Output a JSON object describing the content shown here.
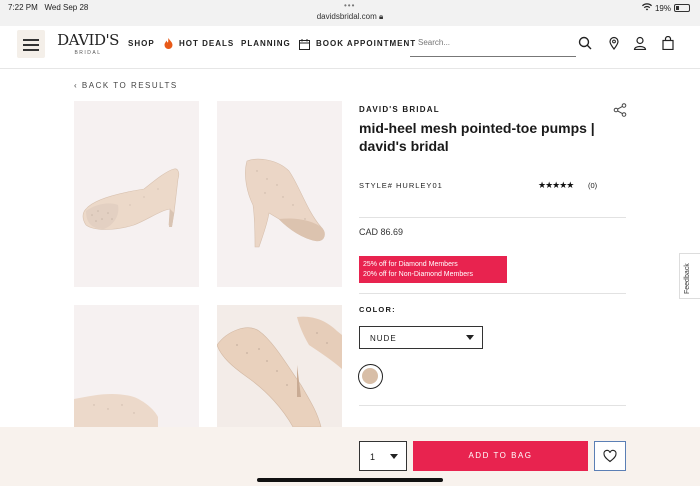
{
  "statusbar": {
    "time": "7:22 PM",
    "date": "Wed Sep 28",
    "url": "davidsbridal.com",
    "battery": "19%"
  },
  "header": {
    "logo": "DAVID'S",
    "logo_sub": "BRIDAL",
    "nav": {
      "shop": "SHOP",
      "hot_deals": "HOT DEALS",
      "planning": "PLANNING",
      "book": "BOOK APPOINTMENT"
    },
    "search_placeholder": "Search..."
  },
  "back_link": "BACK TO RESULTS",
  "product": {
    "brand": "DAVID'S BRIDAL",
    "title": "mid-heel mesh pointed-toe pumps | david's bridal",
    "style": "STYLE# HURLEY01",
    "stars": "★★★★★",
    "review_count": "(0)",
    "price": "CAD 86.69",
    "promo_line1": "25% off for Diamond Members",
    "promo_line2": "20% off for Non-Diamond Members",
    "color_label": "COLOR:",
    "color_value": "NUDE",
    "swatch_color": "#d8bea7"
  },
  "feedback": "Feedback",
  "cart": {
    "qty": "1",
    "add_to_bag": "ADD TO BAG"
  },
  "colors": {
    "accent_pink": "#e8234f",
    "sticky_bg": "#f8f2ed"
  }
}
